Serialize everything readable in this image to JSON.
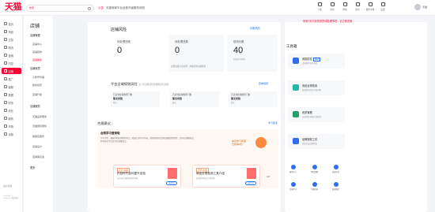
{
  "header": {
    "logo": "天猫",
    "logo_sub": "TMALL.COM",
    "search_tag": "搜索",
    "notice_tag": "公告",
    "notice_text": "天猫商家平台全新升级服务体验",
    "icons": [
      {
        "label": "下载",
        "icon": "download-icon"
      },
      {
        "label": "消息",
        "icon": "message-icon"
      },
      {
        "label": "帮助",
        "icon": "help-icon"
      },
      {
        "label": "建议",
        "icon": "feedback-icon"
      },
      {
        "label": "服务市场",
        "icon": "market-icon"
      },
      {
        "label": "设置",
        "icon": "settings-icon"
      }
    ],
    "user_name": "天猫"
  },
  "left_nav": {
    "items": [
      {
        "label": "首页",
        "active": false
      },
      {
        "label": "商品",
        "active": false
      },
      {
        "label": "交易",
        "active": false
      },
      {
        "label": "物流",
        "active": false
      },
      {
        "label": "营销",
        "active": false
      },
      {
        "label": "内容",
        "active": false
      },
      {
        "label": "店铺",
        "active": true
      },
      {
        "label": "推广",
        "active": false
      },
      {
        "label": "客服",
        "active": false
      },
      {
        "label": "数据",
        "active": false
      },
      {
        "label": "财务",
        "active": false
      },
      {
        "label": "成长",
        "active": false
      },
      {
        "label": "服务",
        "active": false
      },
      {
        "label": "市场",
        "active": false
      },
      {
        "label": "设置",
        "active": false
      }
    ],
    "footer_label": "设计反馈",
    "footer_copy": "Copyright © Tmall.com 版权所有"
  },
  "sub_nav": {
    "title": "店铺",
    "groups": [
      {
        "label": "店铺管理",
        "items": [
          "店铺中心",
          "店铺装修",
          "店铺体检"
        ]
      },
      {
        "label": "店铺资质",
        "items": [
          "子账号管理",
          "我的经营",
          "店铺升级"
        ]
      },
      {
        "label": "店铺服务",
        "items": [
          "天猫品牌服务",
          "天猫国际服务",
          "旗舰店服务",
          "店铺设计",
          "店铺保证金"
        ]
      }
    ],
    "more": "更多"
  },
  "risk": {
    "title": "店铺风险",
    "link": "诊断风险",
    "cards": [
      {
        "label": "待处理违规",
        "value": "0",
        "unit": "",
        "sub": "",
        "sub2": ""
      },
      {
        "label": "待处理违规",
        "value": "0",
        "unit": "",
        "sub": "",
        "sub2": "近期违规记录说明：查看近期违规情况"
      },
      {
        "label": "信用分数",
        "value": "40",
        "unit": "分",
        "sub": "信用分评估中",
        "sub2": ""
      }
    ]
  },
  "rules": {
    "title": "平台全域规则风险",
    "note": "近7天违规风险及规则变化提醒",
    "link": "查看规则",
    "boxes": [
      {
        "t1": "已达到处理规则门槛",
        "t2": "暂无风险",
        "t3": "暂无"
      },
      {
        "t1": "已达到处理规则门槛",
        "t2": "暂无风险",
        "t3": "暂无"
      },
      {
        "t1": "已达到处理规则门槛",
        "t2": "暂无风险",
        "t3": "暂无"
      }
    ]
  },
  "reco": {
    "title": "合规建议",
    "link": "学习更多",
    "head": "合规学习营来啦",
    "desc": "学习专区：根据你的店铺经营特点，精选合规学习内容，帮助你提前识别和规避经营风险，提升店铺健康度，获得更多平台扶持和流量机会。",
    "badge_line1": "本月学习奖励",
    "badge_line2": "已获得0分",
    "cards": [
      {
        "tag": "已学习0课",
        "caption": "内容时代如何提升自检",
        "desc": "从内容合规角度提升经营",
        "button": "去学习"
      },
      {
        "tag": "已学习0课",
        "caption": "商品合规检测工具介绍",
        "desc": "高效检测商品合规风险",
        "button": "去学习"
      }
    ],
    "pager": "1/2"
  },
  "workbench": {
    "top_notice": "你有7天内未完成的待处理事项，请立即查看",
    "title": "工具箱",
    "tools": [
      {
        "name": "风险防控",
        "tag": "NEW",
        "desc": "店铺风险实时监控",
        "color": "#2f6df6"
      },
      {
        "name": "商品合规检测",
        "tag": "",
        "desc": "批量检测商品合规问题",
        "color": "#25b7a8"
      },
      {
        "name": "资质管理",
        "tag": "",
        "desc": "店铺资质材料在线管理",
        "color": "#23a06c"
      },
      {
        "name": "品牌授权工具",
        "tag": "",
        "desc": "快速完成品牌授权",
        "color": "#2f6df6"
      }
    ],
    "mini": [
      "规则中心",
      "风险提醒",
      "违规申诉",
      "合规学习",
      "专题指南",
      "商家服务"
    ]
  }
}
